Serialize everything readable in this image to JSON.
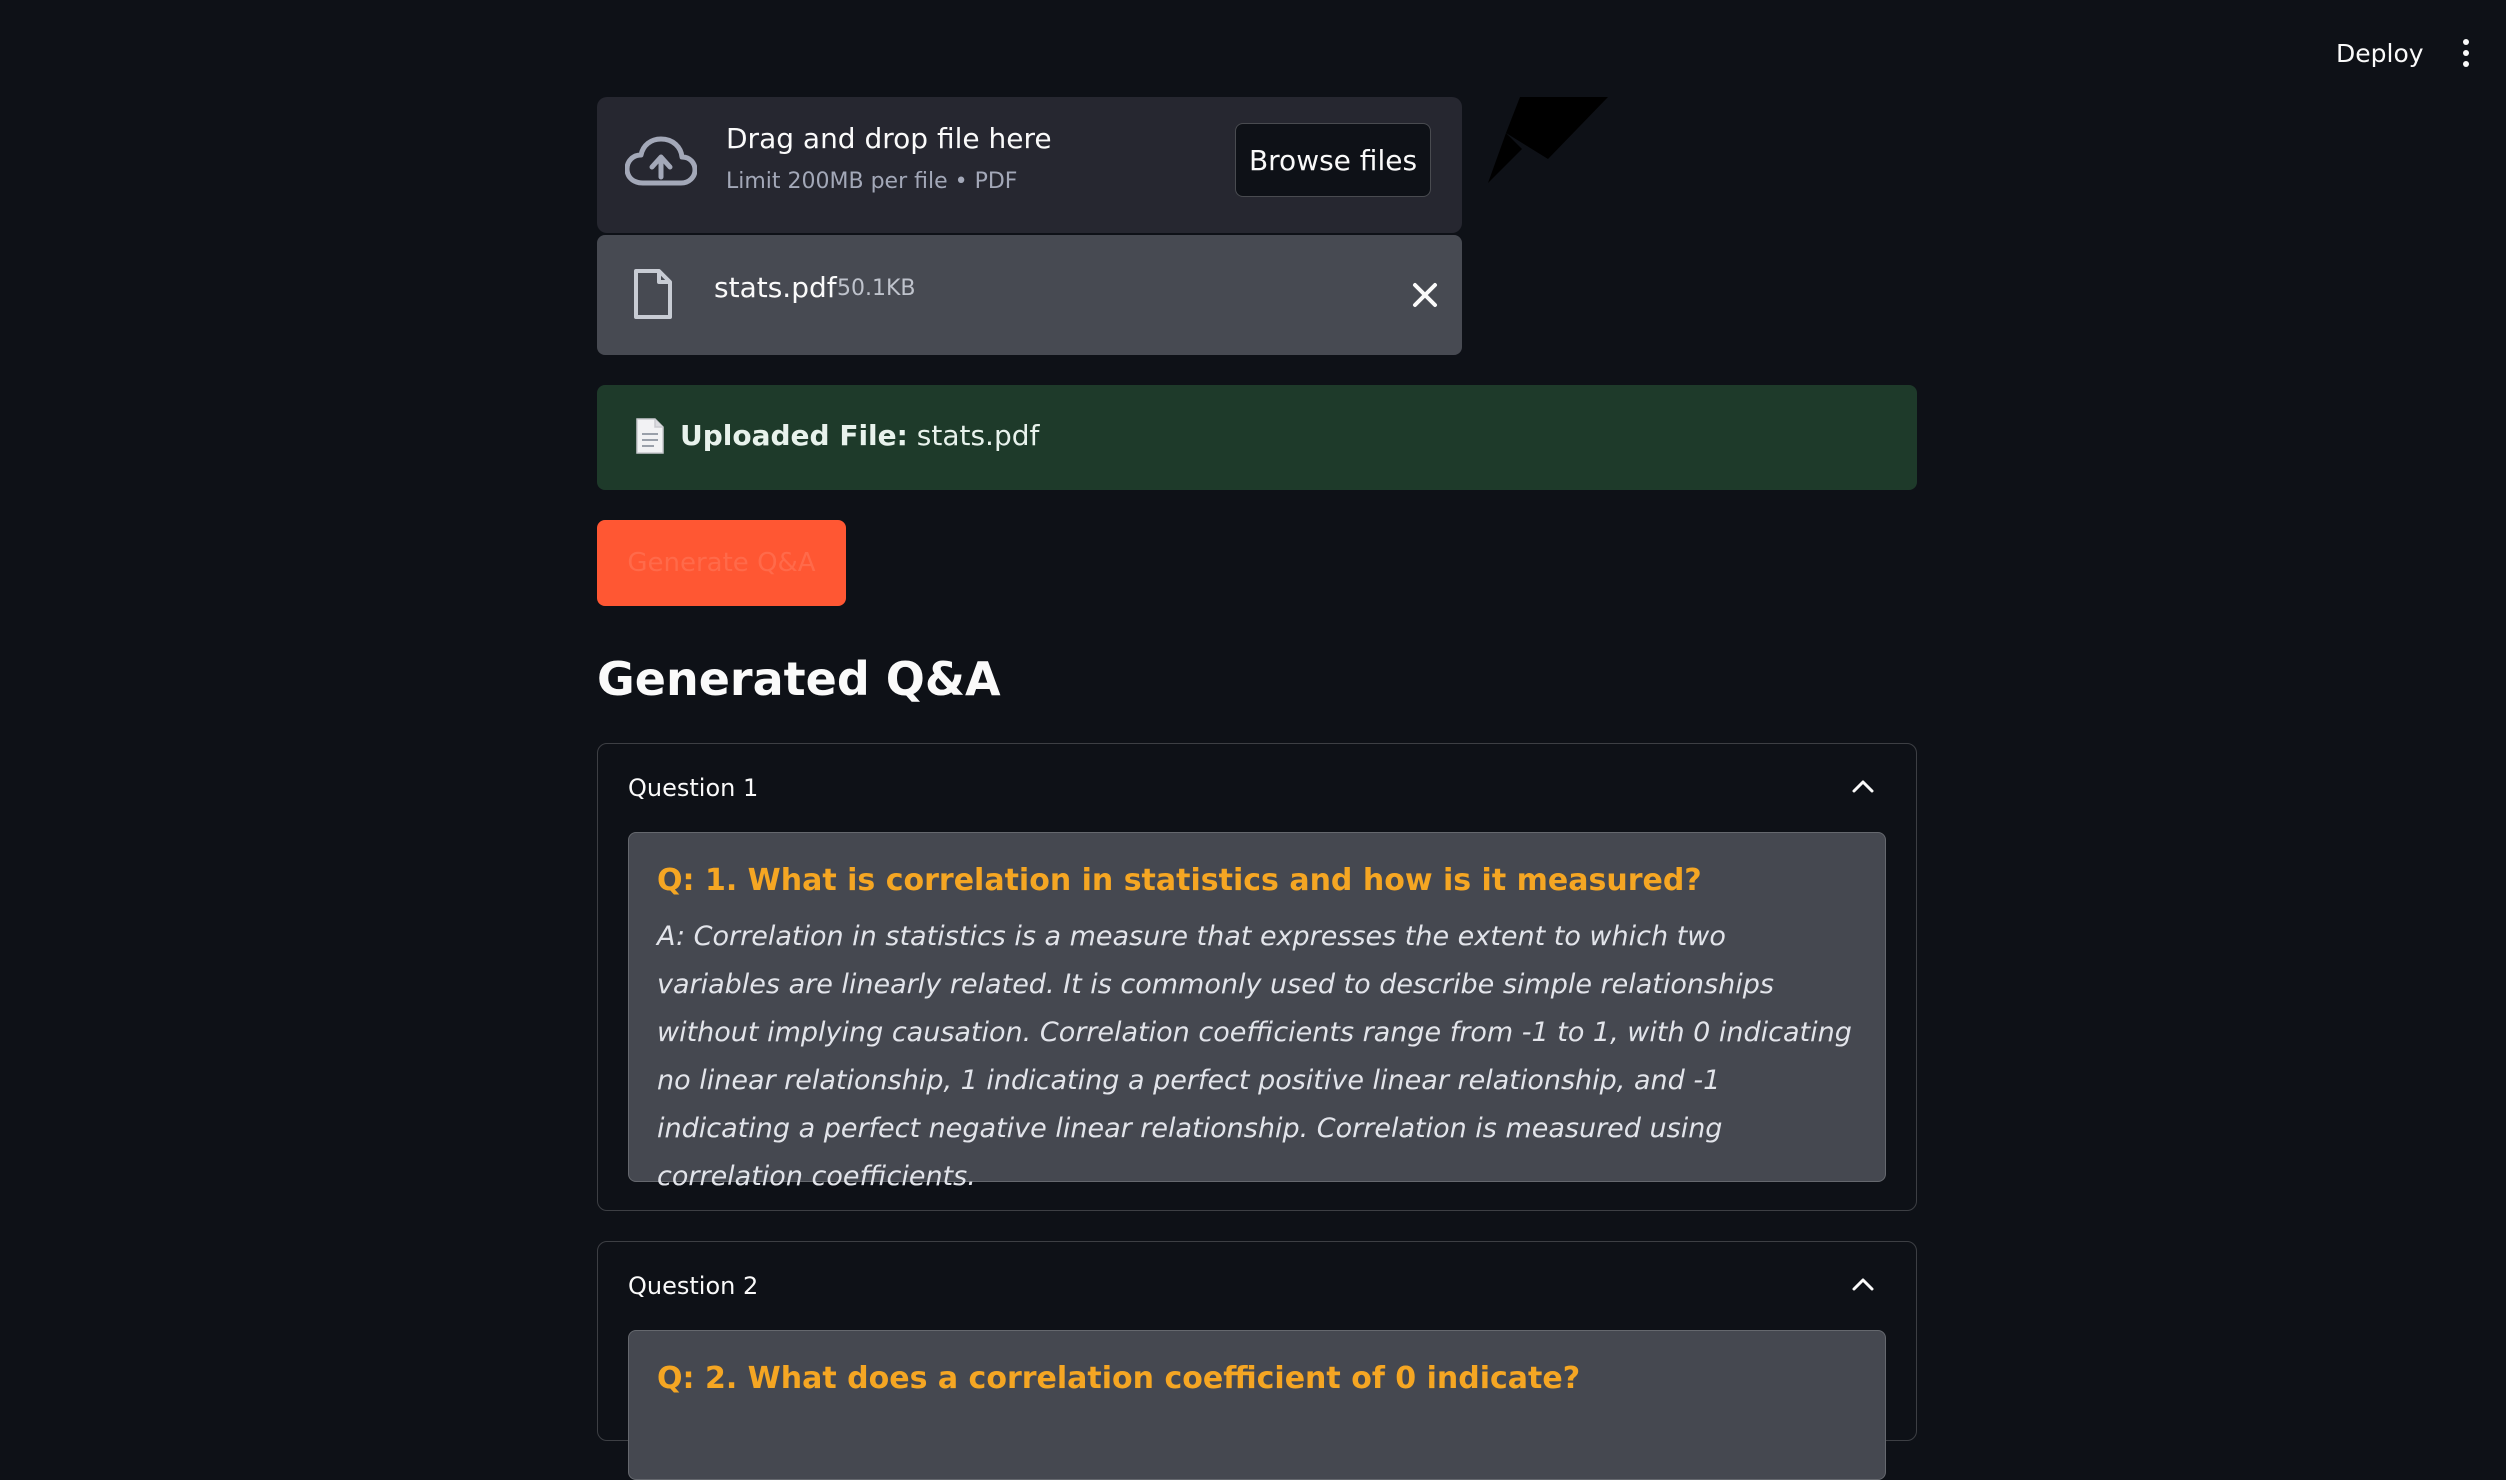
{
  "header": {
    "deploy_label": "Deploy",
    "menu_icon": "kebab-menu-icon"
  },
  "uploader": {
    "title": "Drag and drop file here",
    "subtitle": "Limit 200MB per file • PDF",
    "browse_label": "Browse files",
    "icon": "cloud-upload-icon"
  },
  "uploaded_file": {
    "name": "stats.pdf",
    "size": "50.1KB",
    "icon": "file-icon"
  },
  "success": {
    "label": "Uploaded File:",
    "value": "stats.pdf",
    "icon": "document-emoji-icon"
  },
  "generate_button": {
    "label": "Generate Q&A",
    "color": "#ff5733"
  },
  "section": {
    "title": "Generated Q&A"
  },
  "qa": [
    {
      "header": "Question 1",
      "question": "Q: 1. What is correlation in statistics and how is it measured?",
      "answer": "A: Correlation in statistics is a measure that expresses the extent to which two variables are linearly related. It is commonly used to describe simple relationships without implying causation. Correlation coefficients range from -1 to 1, with 0 indicating no linear relationship, 1 indicating a perfect positive linear relationship, and -1 indicating a perfect negative linear relationship. Correlation is measured using correlation coefficients."
    },
    {
      "header": "Question 2",
      "question": "Q: 2. What does a correlation coefficient of 0 indicate?",
      "answer": ""
    }
  ],
  "colors": {
    "background": "#0e1117",
    "question_accent": "#f5a623",
    "success_bg": "#1e3a2a"
  }
}
